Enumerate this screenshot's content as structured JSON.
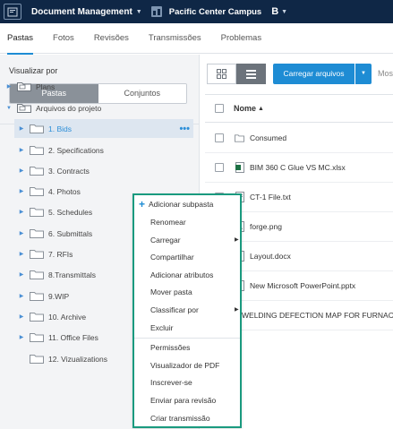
{
  "topbar": {
    "app_title": "Document Management",
    "project_name": "Pacific Center Campus",
    "brand_letter": "B",
    "colors": {
      "bar": "#0f2746",
      "accent": "#1e8cd4"
    }
  },
  "tabs": [
    {
      "label": "Pastas",
      "active": true
    },
    {
      "label": "Fotos"
    },
    {
      "label": "Revisões"
    },
    {
      "label": "Transmissões"
    },
    {
      "label": "Problemas"
    }
  ],
  "left": {
    "view_label": "Visualizar por",
    "seg_on": "Pastas",
    "seg_off": "Conjuntos",
    "tree": [
      {
        "label": "Plans",
        "icon": "plans-folder-icon"
      },
      {
        "label": "Arquivos do projeto",
        "icon": "project-files-folder-icon",
        "expanded": true
      },
      {
        "label": "1. Bids",
        "selected": true,
        "more": "•••"
      },
      {
        "label": "2. Specifications"
      },
      {
        "label": "3. Contracts"
      },
      {
        "label": "4. Photos"
      },
      {
        "label": "5. Schedules"
      },
      {
        "label": "6. Submittals"
      },
      {
        "label": "7. RFIs"
      },
      {
        "label": "8.Transmittals"
      },
      {
        "label": "9.WIP"
      },
      {
        "label": "10. Archive"
      },
      {
        "label": "11. Office Files"
      },
      {
        "label": "12. Vizualizations"
      }
    ]
  },
  "right": {
    "upload_label": "Carregar arquivos",
    "show_label": "Mos",
    "name_header": "Nome",
    "files": [
      {
        "name": "Consumed",
        "icon": "folder-icon"
      },
      {
        "name": "BIM 360 C Glue VS MC.xlsx",
        "icon": "excel-file-icon"
      },
      {
        "name": "CT-1 File.txt",
        "icon": "text-file-icon"
      },
      {
        "name": "forge.png",
        "icon": "image-file-icon"
      },
      {
        "name": "Layout.docx",
        "icon": "word-file-icon"
      },
      {
        "name": "New Microsoft PowerPoint.pptx",
        "icon": "powerpoint-file-icon"
      },
      {
        "name": "WELDING DEFECTION MAP FOR FURNAC",
        "icon": "pdf-file-icon"
      }
    ]
  },
  "menu": {
    "first": "Adicionar subpasta",
    "items_group1": [
      {
        "label": "Renomear"
      },
      {
        "label": "Carregar",
        "submenu": true
      },
      {
        "label": "Compartilhar"
      },
      {
        "label": "Adicionar atributos"
      },
      {
        "label": "Mover pasta"
      },
      {
        "label": "Classificar por",
        "submenu": true
      },
      {
        "label": "Excluir"
      }
    ],
    "items_group2": [
      {
        "label": "Permissões"
      },
      {
        "label": "Visualizador de PDF"
      },
      {
        "label": "Inscrever-se"
      },
      {
        "label": "Enviar para revisão"
      },
      {
        "label": "Criar transmissão"
      }
    ]
  }
}
